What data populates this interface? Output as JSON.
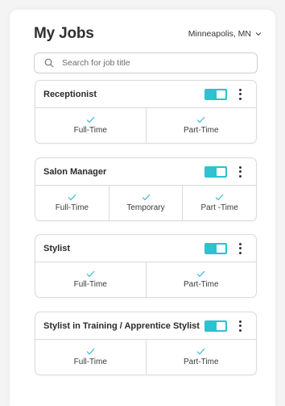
{
  "header": {
    "title": "My Jobs",
    "location": "Minneapolis, MN"
  },
  "search": {
    "placeholder": "Search for job title",
    "value": ""
  },
  "colors": {
    "accent": "#2cc2cf",
    "check": "#3bb8d8"
  },
  "icons": [
    "search-icon",
    "chevron-down-icon",
    "check-icon",
    "more-vert-icon",
    "toggle-switch"
  ],
  "jobs": [
    {
      "title": "Receptionist",
      "enabled": true,
      "types": [
        "Full-Time",
        "Part-Time"
      ]
    },
    {
      "title": "Salon Manager",
      "enabled": true,
      "types": [
        "Full-Time",
        "Temporary",
        "Part -Time"
      ]
    },
    {
      "title": "Stylist",
      "enabled": true,
      "types": [
        "Full-Time",
        "Part-Time"
      ]
    },
    {
      "title": "Stylist in Training / Apprentice Stylist",
      "enabled": true,
      "types": [
        "Full-Time",
        "Part-Time"
      ]
    }
  ]
}
